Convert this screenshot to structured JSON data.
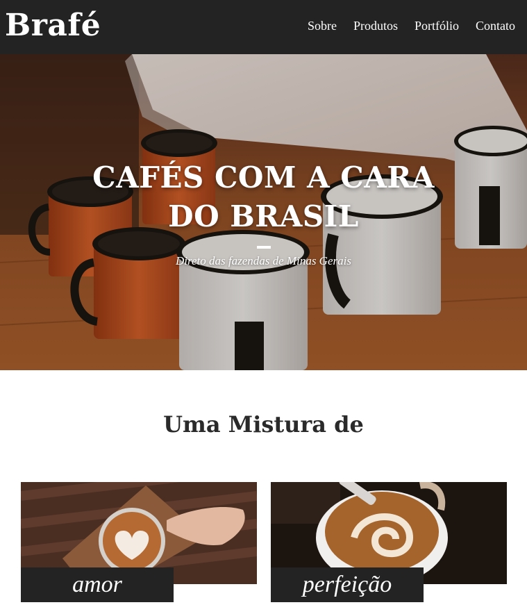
{
  "header": {
    "logo": "Brafé",
    "nav": [
      "Sobre",
      "Produtos",
      "Portfólio",
      "Contato"
    ]
  },
  "hero": {
    "title": "CAFÉS COM A CARA DO BRASIL",
    "subtitle": "Direto das fazendas de Minas Gerais"
  },
  "section": {
    "title": "Uma Mistura de",
    "cards": [
      {
        "label": "amor"
      },
      {
        "label": "perfeição"
      }
    ]
  },
  "colors": {
    "header_bg": "#232323",
    "text_light": "#ffffff",
    "title_dark": "#2a2a2a"
  }
}
